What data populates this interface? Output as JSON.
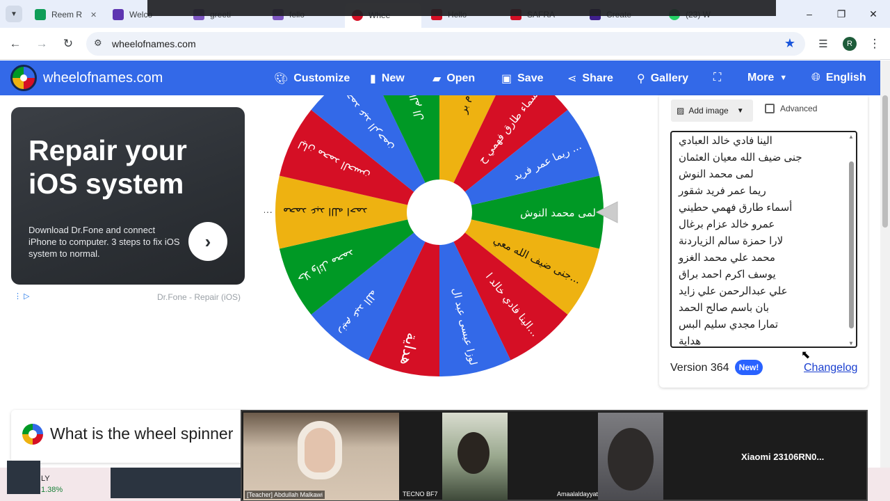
{
  "browser": {
    "tabs": [
      {
        "label": "Reem R",
        "favicon_color": "#0f9d58",
        "active": false
      },
      {
        "label": "Welco",
        "favicon_color": "#5e35b1",
        "active": false
      },
      {
        "label": "greeti",
        "favicon_color": "#7e57c2",
        "active": false
      },
      {
        "label": "fello",
        "favicon_color": "#7e57c2",
        "active": false
      },
      {
        "label": "Whee",
        "favicon_color": "#d50f25",
        "active": true
      },
      {
        "label": "Hello",
        "favicon_color": "#d50f25",
        "active": false
      },
      {
        "label": "SAFRA",
        "favicon_color": "#d50f25",
        "active": false
      },
      {
        "label": "Create",
        "favicon_color": "#3f1f8c",
        "active": false
      },
      {
        "label": "(23) W",
        "favicon_color": "#25d366",
        "active": false
      }
    ],
    "url": "wheelofnames.com",
    "profile_initial": "R",
    "window_controls": {
      "minimize": "–",
      "restore": "❐",
      "close": "✕"
    }
  },
  "site": {
    "name": "wheelofnames.com",
    "menu": [
      {
        "label": "Customize",
        "icon": "palette-icon"
      },
      {
        "label": "New",
        "icon": "file-icon"
      },
      {
        "label": "Open",
        "icon": "folder-icon"
      },
      {
        "label": "Save",
        "icon": "save-icon"
      },
      {
        "label": "Share",
        "icon": "share-icon"
      },
      {
        "label": "Gallery",
        "icon": "search-icon"
      },
      {
        "label": "",
        "icon": "fullscreen-icon"
      },
      {
        "label": "More",
        "icon": "caret-down-icon"
      },
      {
        "label": "English",
        "icon": "globe-icon"
      }
    ],
    "brand_colors": {
      "blue": "#3369e8",
      "red": "#d50f25",
      "yellow": "#eeb211",
      "green": "#009925"
    }
  },
  "ad": {
    "title": "Repair your iOS system",
    "body": "Download Dr.Fone and connect iPhone to computer. 3 steps to fix iOS system to normal.",
    "attribution": "Dr.Fone - Repair (iOS)"
  },
  "wheel": {
    "segments": [
      {
        "label": "لمى محمد النوش",
        "color": "#009925"
      },
      {
        "label": "جنى ضيف الله معي...",
        "color": "#eeb211"
      },
      {
        "label": "الينا فادي خالد ا...",
        "color": "#d50f25"
      },
      {
        "label": "لوزا عيسى عبد ال",
        "color": "#3369e8"
      },
      {
        "label": "هداية",
        "color": "#d50f25"
      },
      {
        "label": "رنيم عبد الله",
        "color": "#3369e8"
      },
      {
        "label": "حلا وائل محمد",
        "color": "#009925"
      },
      {
        "label": "محمد عبد الله احمد",
        "color": "#eeb211"
      },
      {
        "label": "ليان محمد الحسن",
        "color": "#d50f25"
      },
      {
        "label": "محمد عبد الرحمن",
        "color": "#3369e8"
      },
      {
        "label": "حمزة سالم ال",
        "color": "#009925"
      },
      {
        "label": "خالد عزام بر",
        "color": "#eeb211"
      },
      {
        "label": "أسماء طارق فهمي ح",
        "color": "#d50f25"
      },
      {
        "label": "ريما عمر فريد ...",
        "color": "#3369e8"
      }
    ]
  },
  "entries_panel": {
    "add_image_label": "Add image",
    "advanced_label": "Advanced",
    "entries": [
      "الينا فادي خالد العبادي",
      "جنى ضيف الله معيان العثمان",
      "لمى محمد النوش",
      "ريما عمر فريد شقور",
      "أسماء طارق فهمي حطيني",
      "عمرو خالد عزام برغال",
      "لارا حمزة سالم الزياردنة",
      "محمد علي محمد الغزو",
      "يوسف اكرم احمد براق",
      "علي عبدالرحمن علي زايد",
      "بان باسم صالح الحمد",
      "تمارا مجدي سليم البس",
      "هداية"
    ],
    "version": "Version 364",
    "new_badge": "New!",
    "changelog": "Changelog"
  },
  "faq": {
    "title": "What is the wheel spinner"
  },
  "taskbar": {
    "stock_symbol": "LY",
    "stock_change": "1.38%"
  },
  "video_call": {
    "participants": [
      {
        "name": "[Teacher] Abdullah Malkawi"
      },
      {
        "name": "TECNO BF7"
      },
      {
        "name": "Amaalaldayyat"
      },
      {
        "name": "Xiaomi  23106RN0..."
      }
    ]
  }
}
